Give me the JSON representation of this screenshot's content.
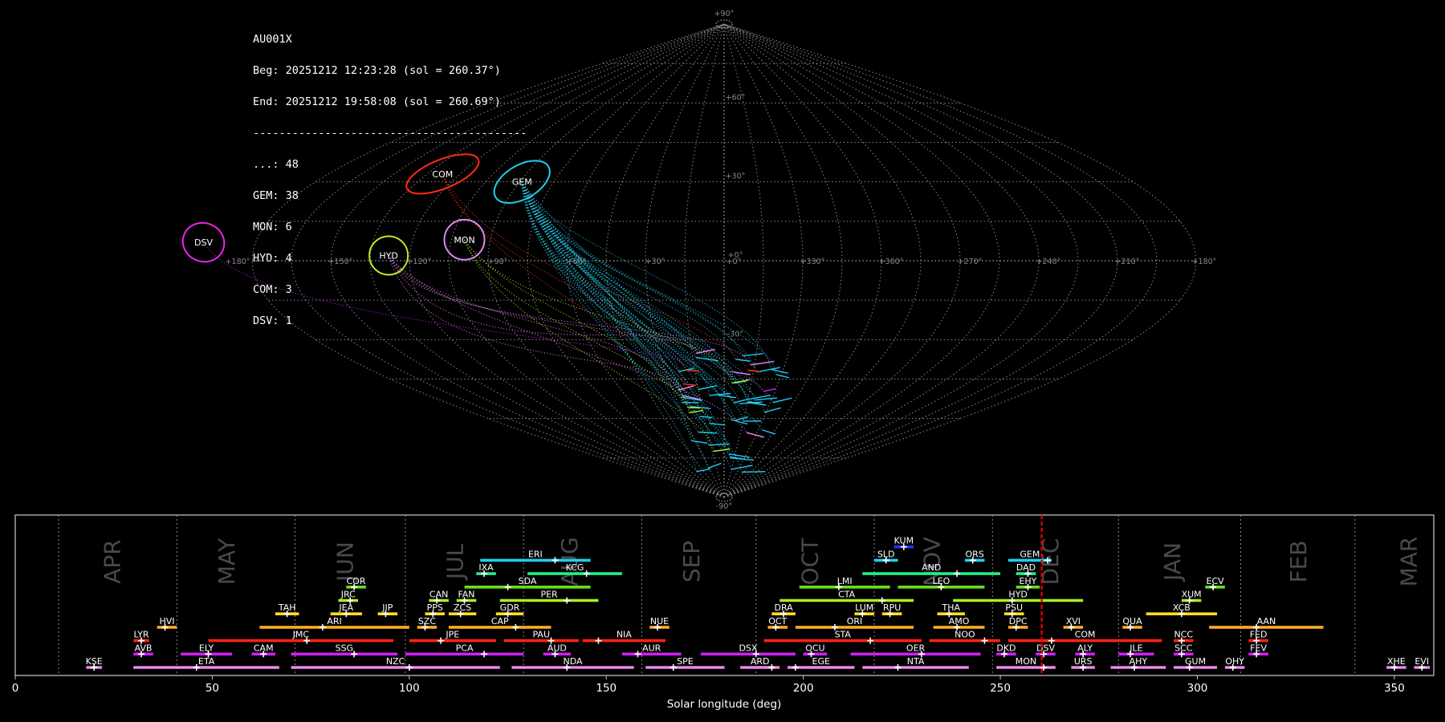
{
  "header": {
    "station": "AU001X",
    "begin": "Beg: 20251212 12:23:28 (sol = 260.37°)",
    "end": "End: 20251212 19:58:08 (sol = 260.69°)",
    "separator": "------------------------------------------"
  },
  "counts": [
    {
      "text": "...: 48"
    },
    {
      "text": "GEM: 38"
    },
    {
      "text": "MON: 6"
    },
    {
      "text": "HYD: 4"
    },
    {
      "text": "COM: 3"
    },
    {
      "text": "DSV: 1"
    }
  ],
  "colors": {
    "background": "#000000",
    "grid": "#8a8a8a",
    "cursor": "#e00000"
  },
  "sky_map": {
    "lat_labels": [
      "+90°",
      "+60°",
      "+30°",
      "+0°",
      "-30°",
      "-90°"
    ],
    "lon_labels": [
      "+180°",
      "+150°",
      "+120°",
      "+90°",
      "+60°",
      "+30°",
      "+0°",
      "+330°",
      "+300°",
      "+270°",
      "+240°",
      "+210°",
      "+180°"
    ],
    "radiants": [
      {
        "name": "COM",
        "lon": 128,
        "lat": 33,
        "rw": 48,
        "rh": 18,
        "rot": -22,
        "color": "#ff2a1a"
      },
      {
        "name": "GEM",
        "lon": 89,
        "lat": 30,
        "rw": 38,
        "rh": 21,
        "rot": -30,
        "color": "#22ccee"
      },
      {
        "name": "HYD",
        "lon": 128,
        "lat": 2,
        "rw": 24,
        "rh": 24,
        "rot": 0,
        "color": "#bbee22"
      },
      {
        "name": "MON",
        "lon": 100,
        "lat": 8,
        "rw": 25,
        "rh": 25,
        "rot": 0,
        "color": "#dd88ee"
      },
      {
        "name": "DSV",
        "lon": 200,
        "lat": 7,
        "rw": 26,
        "rh": 24,
        "rot": 20,
        "color": "#ee22ee"
      }
    ]
  },
  "chart_data": {
    "type": "bar",
    "xlabel": "Solar longitude (deg)",
    "xlim": [
      0,
      360
    ],
    "xticks": [
      0,
      50,
      100,
      150,
      200,
      250,
      300,
      350
    ],
    "current_sol": 260.5,
    "month_boundaries": [
      11,
      41,
      71,
      99,
      129,
      159,
      188,
      218,
      248,
      280,
      311,
      340
    ],
    "months": [
      {
        "name": "APR",
        "x": 25
      },
      {
        "name": "MAY",
        "x": 54
      },
      {
        "name": "JUN",
        "x": 84
      },
      {
        "name": "JUL",
        "x": 112
      },
      {
        "name": "AUG",
        "x": 141
      },
      {
        "name": "SEP",
        "x": 172
      },
      {
        "name": "OCT",
        "x": 202
      },
      {
        "name": "NOV",
        "x": 233
      },
      {
        "name": "DEC",
        "x": 263
      },
      {
        "name": "JAN",
        "x": 294
      },
      {
        "name": "FEB",
        "x": 326
      },
      {
        "name": "MAR",
        "x": 354
      }
    ],
    "showers": [
      {
        "code": "KUM",
        "start": 223,
        "end": 228,
        "peak": 225.5,
        "row": 9,
        "color": "#2233ff"
      },
      {
        "code": "ERI",
        "start": 118,
        "end": 146,
        "peak": 137,
        "row": 8,
        "color": "#22ccee"
      },
      {
        "code": "SLD",
        "start": 218,
        "end": 224,
        "peak": 221,
        "row": 8,
        "color": "#22ccee"
      },
      {
        "code": "ORS",
        "start": 241,
        "end": 246,
        "peak": 243,
        "row": 8,
        "color": "#22ccee"
      },
      {
        "code": "GEM",
        "start": 252,
        "end": 263,
        "peak": 262,
        "row": 8,
        "color": "#22ccee"
      },
      {
        "code": "IXA",
        "start": 117,
        "end": 122,
        "peak": 119,
        "row": 7,
        "color": "#22ee88"
      },
      {
        "code": "KCG",
        "start": 130,
        "end": 154,
        "peak": 145,
        "row": 7,
        "color": "#22ee88"
      },
      {
        "code": "AND",
        "start": 215,
        "end": 250,
        "peak": 239,
        "row": 7,
        "color": "#22ee88"
      },
      {
        "code": "DAD",
        "start": 254,
        "end": 259,
        "peak": 257,
        "row": 7,
        "color": "#22ee88"
      },
      {
        "code": "COR",
        "start": 84,
        "end": 89,
        "peak": 86,
        "row": 6,
        "color": "#66dd22"
      },
      {
        "code": "SDA",
        "start": 114,
        "end": 146,
        "peak": 125,
        "row": 6,
        "color": "#66dd22"
      },
      {
        "code": "LMI",
        "start": 199,
        "end": 222,
        "peak": 209,
        "row": 6,
        "color": "#66dd22"
      },
      {
        "code": "LEO",
        "start": 224,
        "end": 246,
        "peak": 235,
        "row": 6,
        "color": "#66dd22"
      },
      {
        "code": "EHY",
        "start": 254,
        "end": 260,
        "peak": 257,
        "row": 6,
        "color": "#66dd22"
      },
      {
        "code": "ECV",
        "start": 302,
        "end": 307,
        "peak": 304,
        "row": 6,
        "color": "#66dd22"
      },
      {
        "code": "JRC",
        "start": 82,
        "end": 87,
        "peak": 85,
        "row": 5,
        "color": "#aaee22"
      },
      {
        "code": "CAN",
        "start": 105,
        "end": 110,
        "peak": 107,
        "row": 5,
        "color": "#aaee22"
      },
      {
        "code": "FAN",
        "start": 112,
        "end": 117,
        "peak": 114,
        "row": 5,
        "color": "#aaee22"
      },
      {
        "code": "PER",
        "start": 123,
        "end": 148,
        "peak": 140,
        "row": 5,
        "color": "#aaee22"
      },
      {
        "code": "CTA",
        "start": 194,
        "end": 228,
        "peak": 220,
        "row": 5,
        "color": "#aaee22"
      },
      {
        "code": "HYD",
        "start": 238,
        "end": 271,
        "peak": 253,
        "row": 5,
        "color": "#aaee22"
      },
      {
        "code": "XUM",
        "start": 296,
        "end": 301,
        "peak": 298,
        "row": 5,
        "color": "#aaee22"
      },
      {
        "code": "TAH",
        "start": 66,
        "end": 72,
        "peak": 69,
        "row": 4,
        "color": "#ffdd22"
      },
      {
        "code": "JEA",
        "start": 80,
        "end": 88,
        "peak": 84,
        "row": 4,
        "color": "#ffdd22"
      },
      {
        "code": "JIP",
        "start": 92,
        "end": 97,
        "peak": 94,
        "row": 4,
        "color": "#ffdd22"
      },
      {
        "code": "PPS",
        "start": 104,
        "end": 109,
        "peak": 106,
        "row": 4,
        "color": "#ffdd22"
      },
      {
        "code": "ZCS",
        "start": 110,
        "end": 117,
        "peak": 113,
        "row": 4,
        "color": "#ffdd22"
      },
      {
        "code": "GDR",
        "start": 122,
        "end": 129,
        "peak": 125,
        "row": 4,
        "color": "#ffdd22"
      },
      {
        "code": "DRA",
        "start": 192,
        "end": 198,
        "peak": 195,
        "row": 4,
        "color": "#ffdd22"
      },
      {
        "code": "LUM",
        "start": 213,
        "end": 218,
        "peak": 215,
        "row": 4,
        "color": "#ffdd22"
      },
      {
        "code": "RPU",
        "start": 220,
        "end": 225,
        "peak": 222,
        "row": 4,
        "color": "#ffdd22"
      },
      {
        "code": "THA",
        "start": 234,
        "end": 241,
        "peak": 237,
        "row": 4,
        "color": "#ffdd22"
      },
      {
        "code": "PSU",
        "start": 251,
        "end": 256,
        "peak": 253,
        "row": 4,
        "color": "#ffdd22"
      },
      {
        "code": "XCB",
        "start": 287,
        "end": 305,
        "peak": 296,
        "row": 4,
        "color": "#ffdd22"
      },
      {
        "code": "HVI",
        "start": 36,
        "end": 41,
        "peak": 38,
        "row": 3,
        "color": "#ffaa22"
      },
      {
        "code": "ARI",
        "start": 62,
        "end": 100,
        "peak": 78,
        "row": 3,
        "color": "#ffaa22"
      },
      {
        "code": "SZC",
        "start": 102,
        "end": 107,
        "peak": 104,
        "row": 3,
        "color": "#ffaa22"
      },
      {
        "code": "CAP",
        "start": 110,
        "end": 136,
        "peak": 127,
        "row": 3,
        "color": "#ffaa22"
      },
      {
        "code": "NUE",
        "start": 161,
        "end": 166,
        "peak": 163,
        "row": 3,
        "color": "#ffaa22"
      },
      {
        "code": "OCT",
        "start": 191,
        "end": 196,
        "peak": 193,
        "row": 3,
        "color": "#ffaa22"
      },
      {
        "code": "ORI",
        "start": 198,
        "end": 228,
        "peak": 208,
        "row": 3,
        "color": "#ffaa22"
      },
      {
        "code": "AMO",
        "start": 233,
        "end": 246,
        "peak": 239,
        "row": 3,
        "color": "#ffaa22"
      },
      {
        "code": "DPC",
        "start": 252,
        "end": 257,
        "peak": 254,
        "row": 3,
        "color": "#ffaa22"
      },
      {
        "code": "XVI",
        "start": 266,
        "end": 271,
        "peak": 268,
        "row": 3,
        "color": "#ffaa22"
      },
      {
        "code": "QUA",
        "start": 281,
        "end": 286,
        "peak": 283,
        "row": 3,
        "color": "#ffaa22"
      },
      {
        "code": "AAN",
        "start": 303,
        "end": 332,
        "peak": 315,
        "row": 3,
        "color": "#ffaa22"
      },
      {
        "code": "LYR",
        "start": 30,
        "end": 34,
        "peak": 32,
        "row": 2,
        "color": "#ff2211"
      },
      {
        "code": "JMC",
        "start": 49,
        "end": 96,
        "peak": 74,
        "row": 2,
        "color": "#ff2211"
      },
      {
        "code": "JPE",
        "start": 100,
        "end": 122,
        "peak": 108,
        "row": 2,
        "color": "#ff2211"
      },
      {
        "code": "PAU",
        "start": 124,
        "end": 143,
        "peak": 136,
        "row": 2,
        "color": "#ff2211"
      },
      {
        "code": "NIA",
        "start": 144,
        "end": 165,
        "peak": 148,
        "row": 2,
        "color": "#ff2211"
      },
      {
        "code": "STA",
        "start": 190,
        "end": 230,
        "peak": 217,
        "row": 2,
        "color": "#ff2211"
      },
      {
        "code": "NOO",
        "start": 232,
        "end": 250,
        "peak": 246,
        "row": 2,
        "color": "#ff2211"
      },
      {
        "code": "COM",
        "start": 252,
        "end": 291,
        "peak": 263,
        "row": 2,
        "color": "#ff2211"
      },
      {
        "code": "NCC",
        "start": 294,
        "end": 299,
        "peak": 296,
        "row": 2,
        "color": "#ff2211"
      },
      {
        "code": "FED",
        "start": 313,
        "end": 318,
        "peak": 315,
        "row": 2,
        "color": "#ff2211"
      },
      {
        "code": "AVB",
        "start": 30,
        "end": 35,
        "peak": 32,
        "row": 1,
        "color": "#cc22ee"
      },
      {
        "code": "ELY",
        "start": 42,
        "end": 55,
        "peak": 49,
        "row": 1,
        "color": "#cc22ee"
      },
      {
        "code": "CAM",
        "start": 60,
        "end": 66,
        "peak": 63,
        "row": 1,
        "color": "#cc22ee"
      },
      {
        "code": "SSG",
        "start": 70,
        "end": 97,
        "peak": 86,
        "row": 1,
        "color": "#cc22ee"
      },
      {
        "code": "PCA",
        "start": 99,
        "end": 129,
        "peak": 119,
        "row": 1,
        "color": "#cc22ee"
      },
      {
        "code": "AUD",
        "start": 134,
        "end": 141,
        "peak": 137,
        "row": 1,
        "color": "#cc22ee"
      },
      {
        "code": "AUR",
        "start": 154,
        "end": 169,
        "peak": 158,
        "row": 1,
        "color": "#cc22ee"
      },
      {
        "code": "DSX",
        "start": 174,
        "end": 198,
        "peak": 188,
        "row": 1,
        "color": "#cc22ee"
      },
      {
        "code": "OCU",
        "start": 200,
        "end": 206,
        "peak": 202,
        "row": 1,
        "color": "#cc22ee"
      },
      {
        "code": "OER",
        "start": 212,
        "end": 245,
        "peak": 230,
        "row": 1,
        "color": "#cc22ee"
      },
      {
        "code": "DKD",
        "start": 249,
        "end": 254,
        "peak": 251,
        "row": 1,
        "color": "#cc22ee"
      },
      {
        "code": "DSV",
        "start": 259,
        "end": 264,
        "peak": 261,
        "row": 1,
        "color": "#cc22ee"
      },
      {
        "code": "ALY",
        "start": 269,
        "end": 274,
        "peak": 271,
        "row": 1,
        "color": "#cc22ee"
      },
      {
        "code": "JLE",
        "start": 280,
        "end": 289,
        "peak": 283,
        "row": 1,
        "color": "#cc22ee"
      },
      {
        "code": "SCC",
        "start": 294,
        "end": 299,
        "peak": 296,
        "row": 1,
        "color": "#cc22ee"
      },
      {
        "code": "FEV",
        "start": 313,
        "end": 318,
        "peak": 315,
        "row": 1,
        "color": "#cc22ee"
      },
      {
        "code": "KSE",
        "start": 18,
        "end": 22,
        "peak": 20,
        "row": 0,
        "color": "#ee88ee"
      },
      {
        "code": "ETA",
        "start": 30,
        "end": 67,
        "peak": 46,
        "row": 0,
        "color": "#ee88ee"
      },
      {
        "code": "NZC",
        "start": 70,
        "end": 123,
        "peak": 100,
        "row": 0,
        "color": "#ee88ee"
      },
      {
        "code": "NDA",
        "start": 126,
        "end": 157,
        "peak": 140,
        "row": 0,
        "color": "#ee88ee"
      },
      {
        "code": "SPE",
        "start": 160,
        "end": 180,
        "peak": 167,
        "row": 0,
        "color": "#ee88ee"
      },
      {
        "code": "ARD",
        "start": 184,
        "end": 194,
        "peak": 192,
        "row": 0,
        "color": "#ee88ee"
      },
      {
        "code": "EGE",
        "start": 196,
        "end": 213,
        "peak": 198,
        "row": 0,
        "color": "#ee88ee"
      },
      {
        "code": "NTA",
        "start": 215,
        "end": 242,
        "peak": 224,
        "row": 0,
        "color": "#ee88ee"
      },
      {
        "code": "MON",
        "start": 249,
        "end": 264,
        "peak": 261,
        "row": 0,
        "color": "#ee88ee"
      },
      {
        "code": "URS",
        "start": 268,
        "end": 274,
        "peak": 271,
        "row": 0,
        "color": "#ee88ee"
      },
      {
        "code": "AHY",
        "start": 278,
        "end": 292,
        "peak": 284,
        "row": 0,
        "color": "#ee88ee"
      },
      {
        "code": "GUM",
        "start": 294,
        "end": 305,
        "peak": 298,
        "row": 0,
        "color": "#ee88ee"
      },
      {
        "code": "OHY",
        "start": 307,
        "end": 312,
        "peak": 309,
        "row": 0,
        "color": "#ee88ee"
      },
      {
        "code": "XHE",
        "start": 348,
        "end": 353,
        "peak": 350,
        "row": 0,
        "color": "#ee88ee"
      },
      {
        "code": "EVI",
        "start": 355,
        "end": 359,
        "peak": 357,
        "row": 0,
        "color": "#ee88ee"
      }
    ]
  }
}
